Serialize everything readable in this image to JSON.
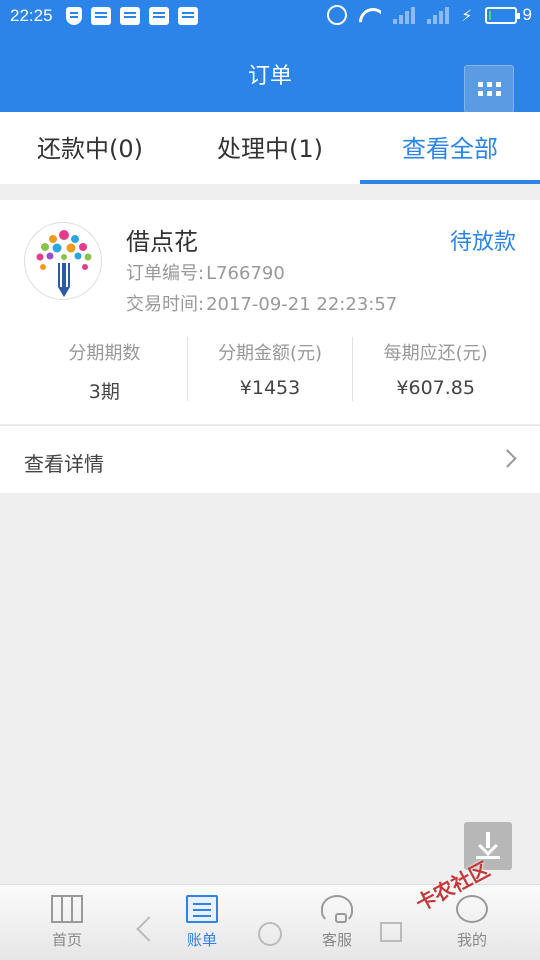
{
  "status_bar": {
    "time": "22:25",
    "battery_level": "9",
    "battery_fraction": 0.09
  },
  "header": {
    "title": "订单"
  },
  "tabs": [
    {
      "label": "还款中(0)",
      "active": false
    },
    {
      "label": "处理中(1)",
      "active": false
    },
    {
      "label": "查看全部",
      "active": true
    }
  ],
  "order": {
    "lender_name": "借点花",
    "status": "待放款",
    "order_no_label": "订单编号:",
    "order_no": "L766790",
    "trade_time_label": "交易时间:",
    "trade_time": "2017-09-21 22:23:57",
    "stats": [
      {
        "label": "分期期数",
        "value": "3期"
      },
      {
        "label": "分期金额(元)",
        "value": "¥1453"
      },
      {
        "label": "每期应还(元)",
        "value": "¥607.85"
      }
    ],
    "detail_link": "查看详情"
  },
  "bottom_nav": [
    {
      "label": "首页",
      "icon": "home-icon",
      "active": false
    },
    {
      "label": "账单",
      "icon": "bill-icon",
      "active": true
    },
    {
      "label": "客服",
      "icon": "headset-icon",
      "active": false
    },
    {
      "label": "我的",
      "icon": "user-icon",
      "active": false
    }
  ],
  "watermark": "卡农社区",
  "colors": {
    "primary": "#2d84e8",
    "background": "#efefef"
  }
}
